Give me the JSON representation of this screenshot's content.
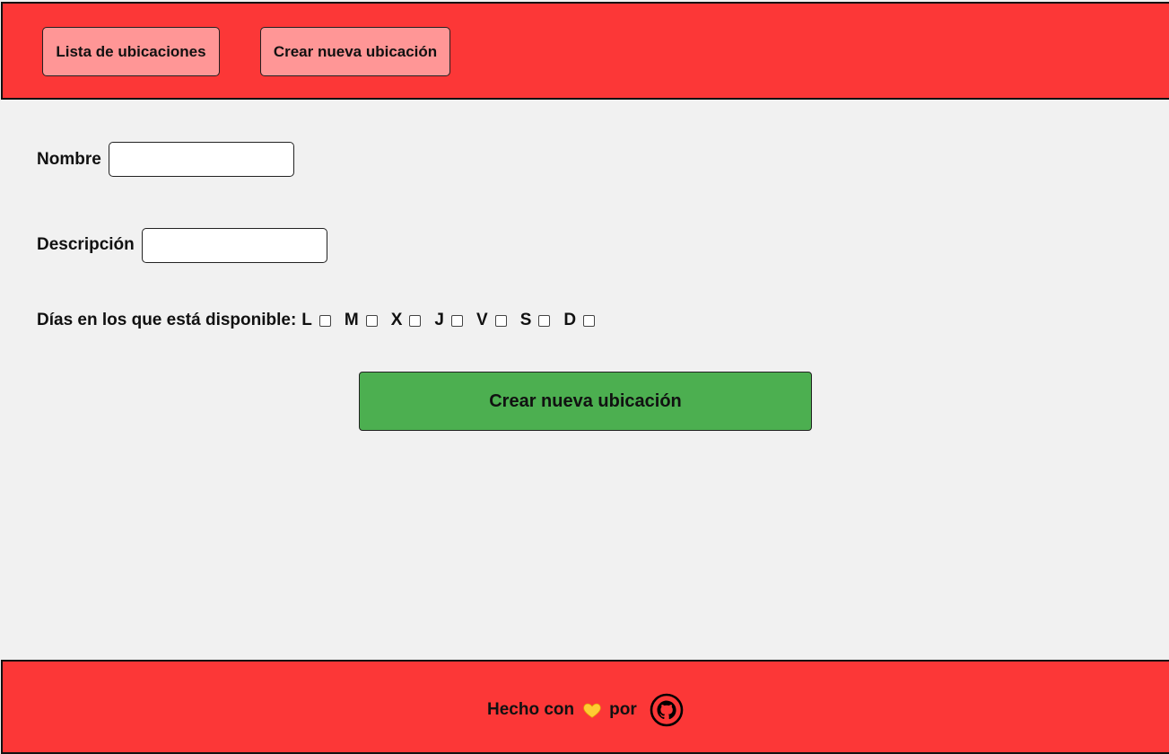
{
  "header": {
    "nav": {
      "list_label": "Lista de ubicaciones",
      "create_label": "Crear nueva ubicación"
    }
  },
  "form": {
    "name_label": "Nombre",
    "name_value": "",
    "description_label": "Descripción",
    "description_value": "",
    "days_label": "Días en los que está disponible:",
    "days": [
      "L",
      "M",
      "X",
      "J",
      "V",
      "S",
      "D"
    ],
    "submit_label": "Crear nueva ubicación"
  },
  "footer": {
    "made_with": "Hecho con",
    "by": "por",
    "heart_icon": "yellow-heart-icon",
    "link_icon": "github-icon"
  },
  "colors": {
    "header_bg": "#fc3737",
    "nav_button_bg": "#ff9696",
    "submit_bg": "#4caf50",
    "page_bg": "#f1f1f1"
  }
}
